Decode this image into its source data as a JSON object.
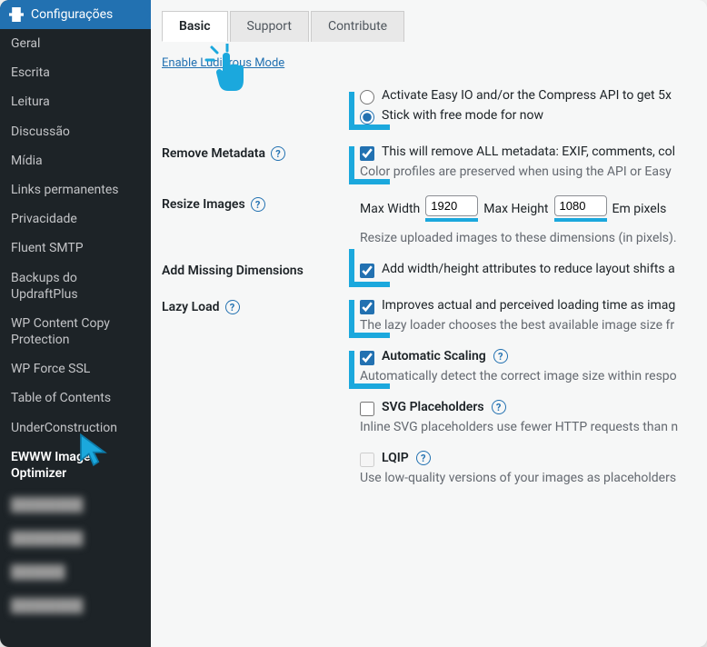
{
  "sidebar": {
    "header": "Configurações",
    "items": [
      "Geral",
      "Escrita",
      "Leitura",
      "Discussão",
      "Mídia",
      "Links permanentes",
      "Privacidade",
      "Fluent SMTP",
      "Backups do UpdraftPlus",
      "WP Content Copy Protection",
      "WP Force SSL",
      "Table of Contents",
      "UnderConstruction",
      "EWWW Image Optimizer"
    ]
  },
  "tabs": {
    "basic": "Basic",
    "support": "Support",
    "contribute": "Contribute"
  },
  "ludicrous_link": "Enable Ludicrous Mode",
  "mode": {
    "activate": "Activate Easy IO and/or the Compress API to get 5x",
    "stick": "Stick with free mode for now"
  },
  "metadata": {
    "label": "Remove Metadata",
    "check": "This will remove ALL metadata: EXIF, comments, col",
    "desc": "Color profiles are preserved when using the API or Easy "
  },
  "resize": {
    "label": "Resize Images",
    "max_width_label": "Max Width",
    "max_width": "1920",
    "max_height_label": "Max Height",
    "max_height": "1080",
    "units": "Em pixels",
    "desc": "Resize uploaded images to these dimensions (in pixels)."
  },
  "dimensions": {
    "label": "Add Missing Dimensions",
    "check": "Add width/height attributes to reduce layout shifts a"
  },
  "lazy": {
    "label": "Lazy Load",
    "check": "Improves actual and perceived loading time as imag",
    "desc": "The lazy loader chooses the best available image size fr"
  },
  "scaling": {
    "check": "Automatic Scaling",
    "desc": "Automatically detect the correct image size within respo"
  },
  "svg": {
    "check": "SVG Placeholders",
    "desc": "Inline SVG placeholders use fewer HTTP requests than n"
  },
  "lqip": {
    "check": "LQIP",
    "desc": "Use low-quality versions of your images as placeholders"
  }
}
